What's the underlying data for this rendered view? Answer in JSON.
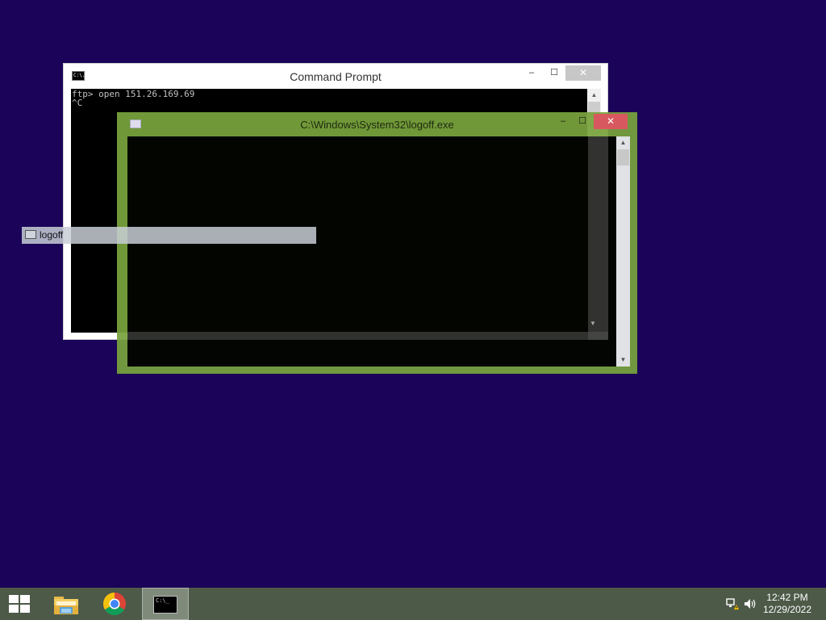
{
  "cmd_window": {
    "title": "Command Prompt",
    "icon": "cmd-icon",
    "icon_text": "C:\\.",
    "lines": [
      "ftp> open 151.26.169.69",
      "^C"
    ],
    "controls": {
      "minimize": "–",
      "maximize": "☐",
      "close": "✕"
    }
  },
  "logoff_window": {
    "title": "C:\\Windows\\System32\\logoff.exe",
    "icon": "console-window-icon",
    "controls": {
      "minimize": "–",
      "maximize": "☐",
      "close": "✕"
    },
    "accent_color": "#78a43c"
  },
  "task_peek": {
    "label": "logoff",
    "icon": "console-window-icon"
  },
  "taskbar": {
    "start": "windows-logo-icon",
    "items": [
      {
        "name": "file-explorer",
        "icon": "folder-icon"
      },
      {
        "name": "chrome",
        "icon": "chrome-icon"
      },
      {
        "name": "command-prompt",
        "icon": "cmd-icon",
        "icon_text": "C:\\_",
        "active": true
      }
    ],
    "tray": {
      "icons": [
        "network-warning-icon",
        "volume-icon"
      ],
      "time": "12:42 PM",
      "date": "12/29/2022"
    }
  },
  "colors": {
    "desktop": "#1a0358",
    "taskbar": "#4d5a48",
    "logoff_close": "#d8585f"
  }
}
